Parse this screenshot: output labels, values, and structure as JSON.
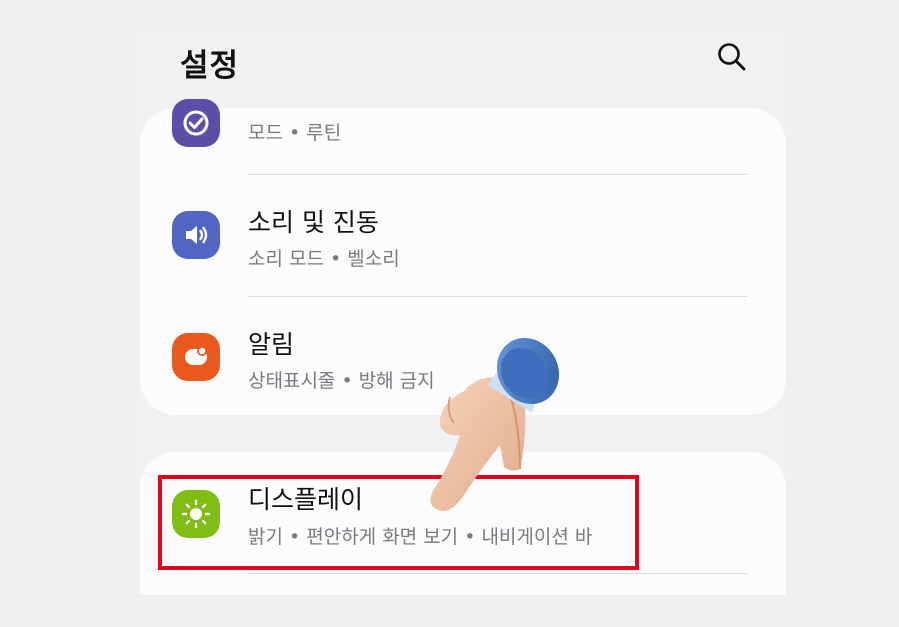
{
  "header": {
    "title": "설정"
  },
  "icons": {
    "search": "search-icon",
    "modes": "modes-routines-icon",
    "sound": "sound-icon",
    "notifications": "notifications-icon",
    "display": "display-icon",
    "hand": "pointing-hand-icon"
  },
  "colors": {
    "modes": "#5b4fa8",
    "sound": "#5165c4",
    "notifications": "#e9581c",
    "display": "#7fbd12",
    "highlight": "#e4011e"
  },
  "items": [
    {
      "title": "",
      "subtitle": "모드 • 루틴"
    },
    {
      "title": "소리 및 진동",
      "subtitle": "소리 모드 • 벨소리"
    },
    {
      "title": "알림",
      "subtitle": "상태표시줄 • 방해 금지"
    },
    {
      "title": "디스플레이",
      "subtitle": "밝기 • 편안하게 화면 보기 • 내비게이션 바"
    }
  ]
}
